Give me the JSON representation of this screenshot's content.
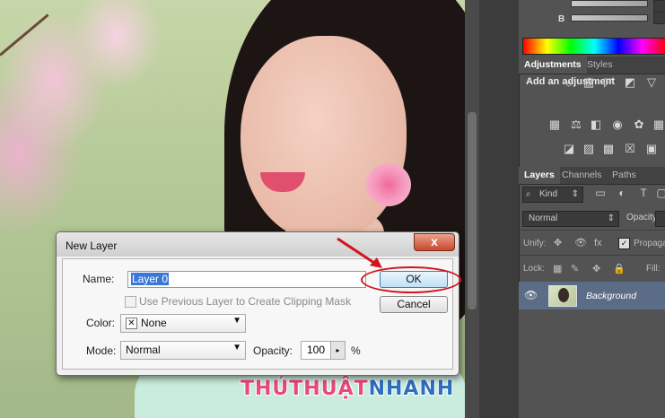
{
  "dialog": {
    "title": "New Layer",
    "close_glyph": "x",
    "name_label": "Name:",
    "name_value": "Layer 0",
    "clip_checkbox_checked": false,
    "clip_label": "Use Previous Layer to Create Clipping Mask",
    "color_label": "Color:",
    "color_value": "None",
    "mode_label": "Mode:",
    "mode_value": "Normal",
    "opacity_label": "Opacity:",
    "opacity_value": "100",
    "opacity_unit": "%",
    "ok_label": "OK",
    "cancel_label": "Cancel"
  },
  "watermark": {
    "part1": "THỦTHUẬT",
    "part2": "NHANH"
  },
  "color_panel": {
    "b_label": "B"
  },
  "adjustments_tabs": [
    {
      "label": "Adjustments",
      "active": true
    },
    {
      "label": "Styles",
      "active": false
    }
  ],
  "adjustments_title": "Add an adjustment",
  "layers_tabs": [
    {
      "label": "Layers",
      "active": true
    },
    {
      "label": "Channels",
      "active": false
    },
    {
      "label": "Paths",
      "active": false
    }
  ],
  "layers_panel": {
    "kind_value": "Kind",
    "blend_mode_value": "Normal",
    "opacity_label": "Opacity:",
    "unify_label": "Unify:",
    "propagate_label": "Propaga",
    "propagate_checked": true,
    "lock_label": "Lock:",
    "fill_label": "Fill:",
    "layer_name": "Background"
  },
  "colors": {
    "accent_red": "#d2141e",
    "layer_selected": "#5b6d86",
    "panel_bg": "#535353"
  }
}
